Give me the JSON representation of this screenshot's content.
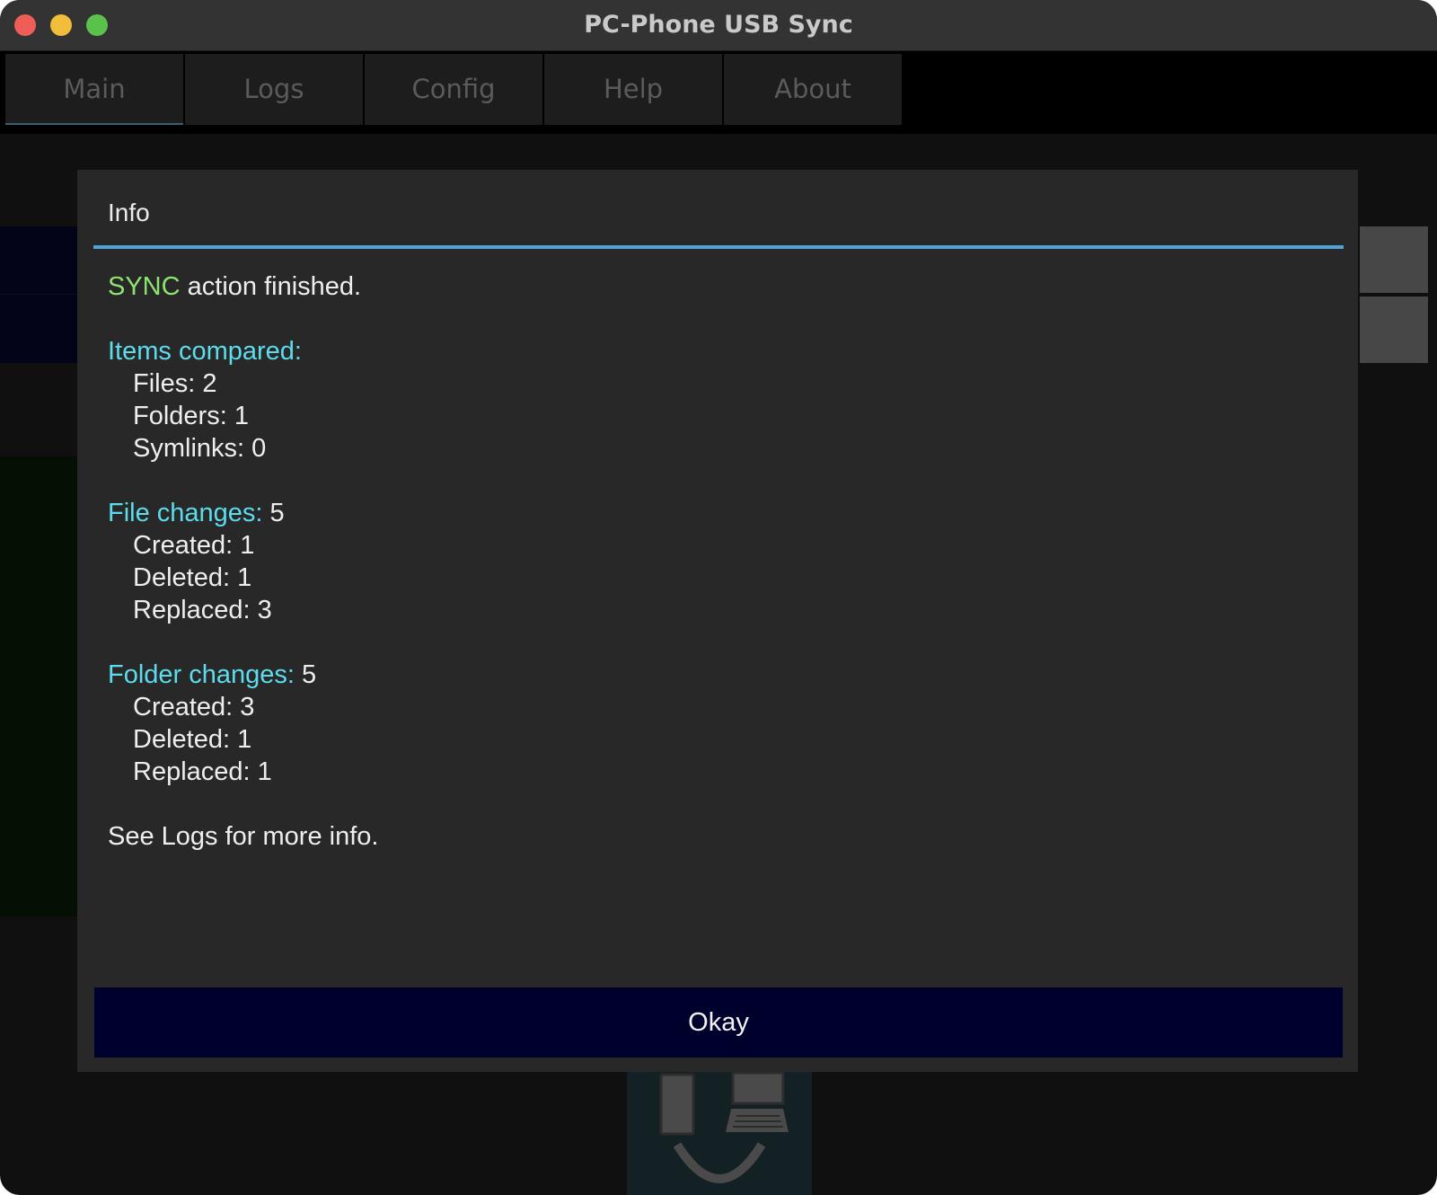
{
  "window": {
    "title": "PC-Phone USB Sync"
  },
  "tabs": [
    {
      "label": "Main",
      "active": true
    },
    {
      "label": "Logs",
      "active": false
    },
    {
      "label": "Config",
      "active": false
    },
    {
      "label": "Help",
      "active": false
    },
    {
      "label": "About",
      "active": false
    }
  ],
  "dialog": {
    "title": "Info",
    "status_keyword": "SYNC",
    "status_rest": " action finished.",
    "items_compared": {
      "heading": "Items compared:",
      "files": "Files: 2",
      "folders": "Folders: 1",
      "symlinks": "Symlinks: 0"
    },
    "file_changes": {
      "heading": "File changes:",
      "total": " 5",
      "created": "Created: 1",
      "deleted": "Deleted: 1",
      "replaced": "Replaced: 3"
    },
    "folder_changes": {
      "heading": "Folder changes:",
      "total": " 5",
      "created": "Created: 3",
      "deleted": "Deleted: 1",
      "replaced": "Replaced: 1"
    },
    "footer_note": "See Logs for more info.",
    "okay_label": "Okay"
  },
  "colors": {
    "accent_rule": "#4ea3d8",
    "keyword_green": "#8ee36e",
    "heading_cyan": "#5cdcec",
    "button_bg": "#00002c"
  }
}
